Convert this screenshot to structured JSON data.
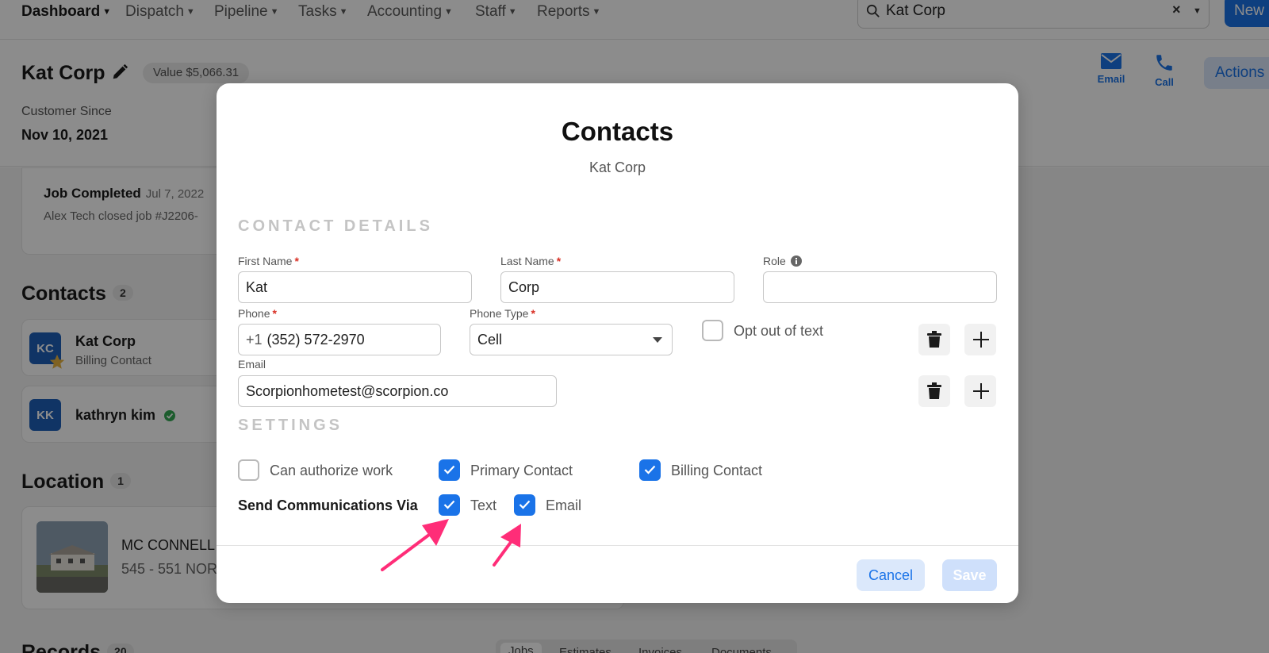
{
  "nav": {
    "items": [
      {
        "label": "Dashboard",
        "active": true
      },
      {
        "label": "Dispatch"
      },
      {
        "label": "Pipeline"
      },
      {
        "label": "Tasks"
      },
      {
        "label": "Accounting"
      },
      {
        "label": "Staff"
      },
      {
        "label": "Reports"
      }
    ],
    "search_value": "Kat Corp",
    "clear_glyph": "×",
    "new_label": "New"
  },
  "customer": {
    "name": "Kat Corp",
    "value_badge": "Value $5,066.31",
    "since_label": "Customer Since",
    "since_date": "Nov 10, 2021",
    "email_action": "Email",
    "call_action": "Call",
    "actions_label": "Actions"
  },
  "activity": {
    "title": "Job Completed",
    "date": "Jul 7, 2022",
    "subtitle": "Alex Tech closed job #J2206-"
  },
  "contacts_section": {
    "title": "Contacts",
    "count": "2",
    "items": [
      {
        "initials": "KC",
        "name": "Kat Corp",
        "role": "Billing Contact"
      },
      {
        "initials": "KK",
        "name": "kathryn kim",
        "role": ""
      }
    ]
  },
  "location_section": {
    "title": "Location",
    "count": "1",
    "name": "MC CONNELL",
    "address": "545 - 551 NOR"
  },
  "records_section": {
    "title": "Records",
    "count": "20",
    "tabs": [
      "Jobs",
      "Estimates",
      "Invoices",
      "Documents"
    ]
  },
  "modal": {
    "title": "Contacts",
    "subtitle": "Kat Corp",
    "details_heading": "CONTACT DETAILS",
    "first_name_label": "First Name",
    "first_name_value": "Kat",
    "last_name_label": "Last Name",
    "last_name_value": "Corp",
    "role_label": "Role",
    "role_value": "",
    "phone_label": "Phone",
    "phone_prefix": "+1",
    "phone_value": "(352) 572-2970",
    "phone_type_label": "Phone Type",
    "phone_type_value": "Cell",
    "opt_out_label": "Opt out of text",
    "email_label": "Email",
    "email_value": "Scorpionhometest@scorpion.co",
    "required_mark": "*",
    "settings_heading": "SETTINGS",
    "can_authorize_label": "Can authorize work",
    "primary_contact_label": "Primary Contact",
    "billing_contact_label": "Billing Contact",
    "send_comm_label": "Send Communications Via",
    "text_label": "Text",
    "email_comm_label": "Email",
    "cancel_label": "Cancel",
    "save_label": "Save",
    "checks": {
      "opt_out": false,
      "can_authorize": false,
      "primary_contact": true,
      "billing_contact": true,
      "text": true,
      "email": true
    }
  },
  "colors": {
    "accent": "#1a73e8",
    "annotation_arrow": "#ff2d78",
    "required": "#d93025"
  }
}
